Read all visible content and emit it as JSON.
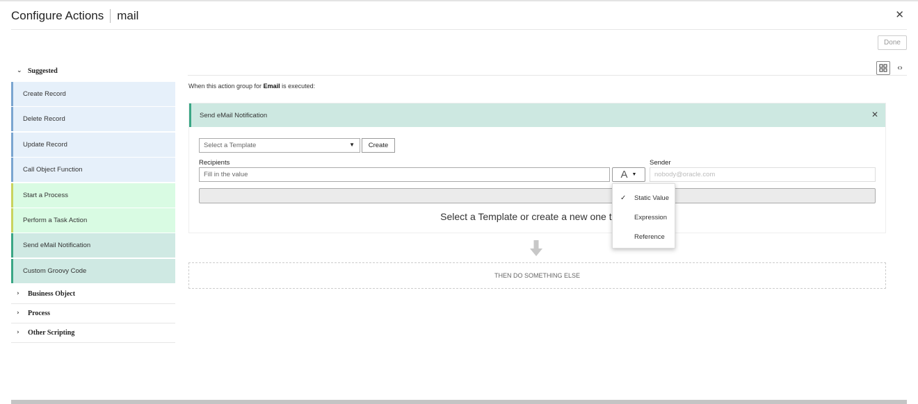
{
  "header": {
    "title": "Configure Actions",
    "subtitle": "mail"
  },
  "toolbar": {
    "done_label": "Done"
  },
  "sidebar": {
    "suggested_label": "Suggested",
    "items": [
      {
        "label": "Create Record",
        "color": "blue"
      },
      {
        "label": "Delete Record",
        "color": "blue"
      },
      {
        "label": "Update Record",
        "color": "blue"
      },
      {
        "label": "Call Object Function",
        "color": "blue"
      },
      {
        "label": "Start a Process",
        "color": "green"
      },
      {
        "label": "Perform a Task Action",
        "color": "green"
      },
      {
        "label": "Send eMail Notification",
        "color": "teal"
      },
      {
        "label": "Custom Groovy Code",
        "color": "teal"
      }
    ],
    "sections": [
      "Business Object",
      "Process",
      "Other Scripting"
    ]
  },
  "main": {
    "when_prefix": "When this action group for ",
    "when_bold": "Email",
    "when_suffix": " is executed:",
    "card": {
      "title": "Send eMail Notification",
      "template_placeholder": "Select a Template",
      "create_label": "Create",
      "recipients_label": "Recipients",
      "recipients_placeholder": "Fill in the value",
      "type_glyph": "A",
      "sender_label": "Sender",
      "sender_placeholder": "nobody@oracle.com",
      "message": "Select a Template or create a new one to sen"
    },
    "dropdown": {
      "options": [
        "Static Value",
        "Expression",
        "Reference"
      ],
      "selected": "Static Value"
    },
    "then_label": "THEN DO SOMETHING ELSE"
  },
  "colors": {
    "blue_item_bg": "#e6f0fa",
    "green_item_bg": "#d9fbe3",
    "teal_item_bg": "#cfe9e3",
    "card_header_bg": "#cde8e1",
    "accent_teal": "#3aa685"
  },
  "icons": {
    "close": "close-icon",
    "view_toggle": "grid-view-icon",
    "code_toggle": "code-icon",
    "down_arrow": "arrow-down-icon",
    "check": "check-icon"
  }
}
